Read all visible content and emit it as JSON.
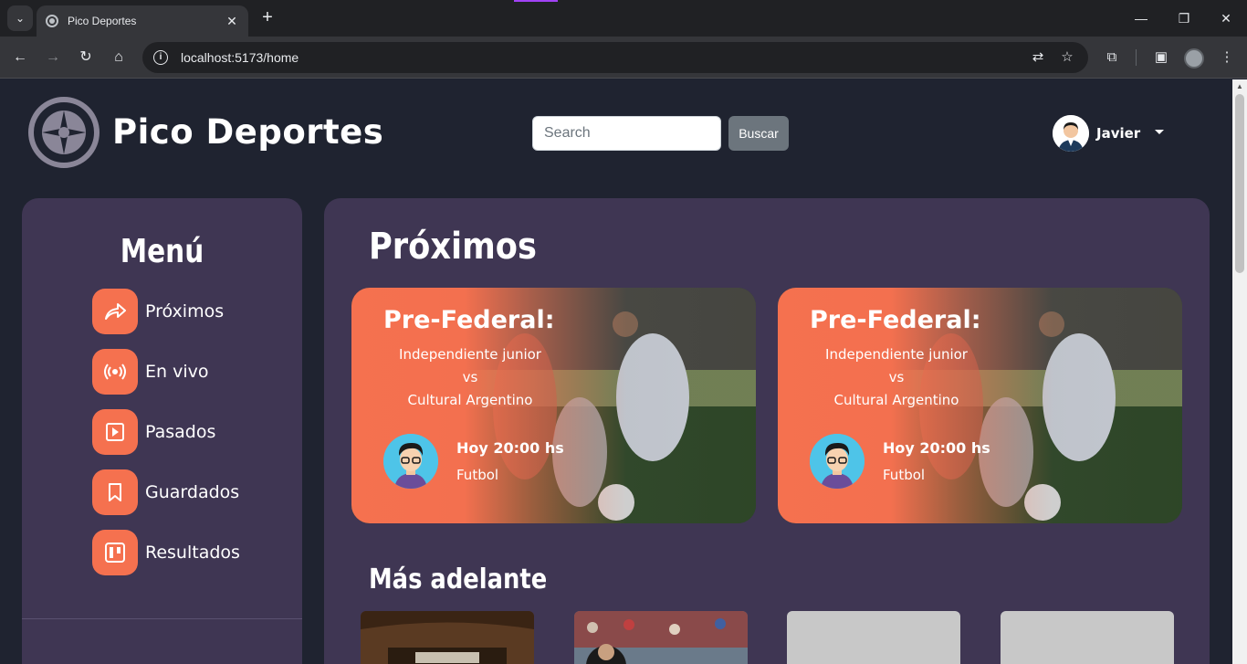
{
  "browser": {
    "tab_title": "Pico Deportes",
    "url": "localhost:5173/home"
  },
  "header": {
    "brand": "Pico Deportes",
    "search_placeholder": "Search",
    "search_button": "Buscar",
    "user_name": "Javier"
  },
  "sidebar": {
    "title": "Menú",
    "items": [
      {
        "label": "Próximos",
        "icon": "share-arrow-icon"
      },
      {
        "label": "En vivo",
        "icon": "broadcast-icon"
      },
      {
        "label": "Pasados",
        "icon": "play-square-icon"
      },
      {
        "label": "Guardados",
        "icon": "bookmark-icon"
      },
      {
        "label": "Resultados",
        "icon": "board-icon"
      }
    ]
  },
  "main": {
    "title": "Próximos",
    "cards": [
      {
        "league": "Pre-Federal:",
        "home": "Independiente junior",
        "vs": "vs",
        "away": "Cultural Argentino",
        "time": "Hoy 20:00 hs",
        "sport": "Futbol"
      },
      {
        "league": "Pre-Federal:",
        "home": "Independiente junior",
        "vs": "vs",
        "away": "Cultural Argentino",
        "time": "Hoy 20:00 hs",
        "sport": "Futbol"
      }
    ],
    "later_title": "Más adelante"
  },
  "colors": {
    "accent": "#f5714f",
    "panel": "#3f3653",
    "background": "#1f2330"
  }
}
